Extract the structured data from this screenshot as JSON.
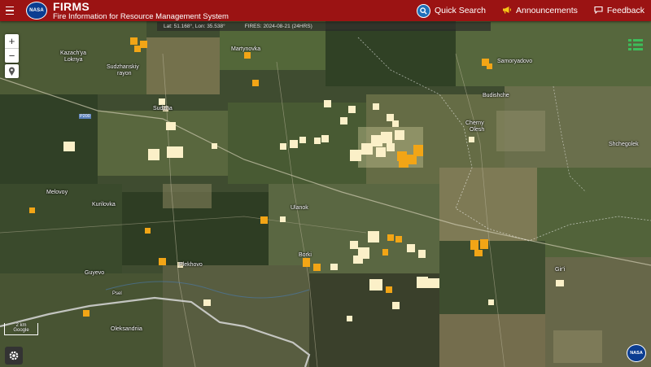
{
  "header": {
    "title": "FIRMS",
    "subtitle": "Fire Information for Resource Management System",
    "logo_text": "NASA",
    "quick_search": "Quick Search",
    "announcements": "Announcements",
    "feedback": "Feedback"
  },
  "coordbar": {
    "latlon": "Lat: 51.168°, Lon: 35.538°",
    "fires": "FIRES: 2024-08-21 (24HRS)"
  },
  "map_controls": {
    "zoom_in": "+",
    "zoom_out": "−",
    "scale_top": "2 km",
    "scale_bottom": "Google"
  },
  "places": [
    {
      "name": "Kazach'ya\nLoknya",
      "label": "Kazach'ya"
    },
    {
      "name": "Loknya",
      "label": "Loknya"
    },
    {
      "name": "Sudzhanskiy",
      "label": "Sudzhanskiy"
    },
    {
      "name": "rayon",
      "label": "rayon"
    },
    {
      "name": "Martynovka",
      "label": "Martynovka"
    },
    {
      "name": "Samoryadovo",
      "label": "Samoryadovo"
    },
    {
      "name": "Budishche",
      "label": "Budishche"
    },
    {
      "name": "Cherny",
      "label": "Cherny"
    },
    {
      "name": "Olesh",
      "label": "Olesh"
    },
    {
      "name": "Shchegolek",
      "label": "Shchegolek"
    },
    {
      "name": "Sudzha",
      "label": "Sudzha"
    },
    {
      "name": "Melovoy",
      "label": "Melovoy"
    },
    {
      "name": "Kurilovka",
      "label": "Kurilovka"
    },
    {
      "name": "Ulanok",
      "label": "Ulanok"
    },
    {
      "name": "Borki",
      "label": "Borki"
    },
    {
      "name": "Plekhovo",
      "label": "Plekhovo"
    },
    {
      "name": "Guyevo",
      "label": "Guyevo"
    },
    {
      "name": "Gir'i",
      "label": "Gir'i"
    },
    {
      "name": "Oleksandriia",
      "label": "Oleksandriia"
    }
  ],
  "road_labels": [
    "P200",
    "Psel"
  ],
  "colors": {
    "header_bg": "#9b1313",
    "fire_orange": "#f2a516",
    "fire_cream": "#fbf0c8",
    "nasa_blue": "#0b3d91"
  },
  "icons": [
    "menu-icon",
    "nasa-logo",
    "search-icon",
    "megaphone-icon",
    "chat-icon",
    "layers-icon",
    "locate-icon",
    "gear-icon"
  ]
}
